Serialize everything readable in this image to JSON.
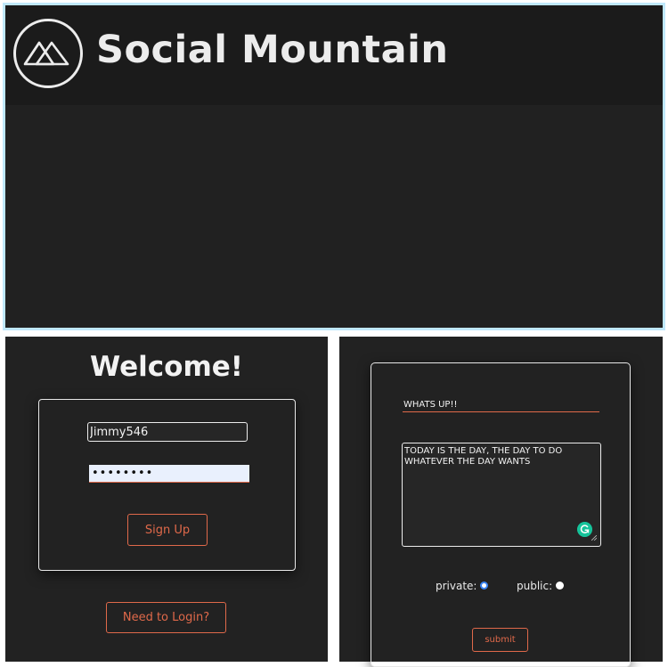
{
  "header": {
    "app_title": "Social Mountain",
    "logo_icon": "mountain-logo-icon"
  },
  "signup": {
    "welcome": "Welcome!",
    "username_value": "Jimmy546",
    "password_value": "••••••••",
    "signup_label": "Sign Up",
    "need_login_label": "Need to Login?"
  },
  "post": {
    "title_value": "WHATS UP!!",
    "body_value": "TODAY IS THE DAY, THE DAY TO DO WHATEVER THE DAY WANTS",
    "grammarly_icon": "grammarly-icon",
    "private_label": "private:",
    "public_label": "public:",
    "private_selected": true,
    "submit_label": "submit"
  },
  "colors": {
    "accent": "#e0694a",
    "background": "#222222",
    "header_bg": "#1b1b1b",
    "frame_border": "#bfe8fb"
  }
}
